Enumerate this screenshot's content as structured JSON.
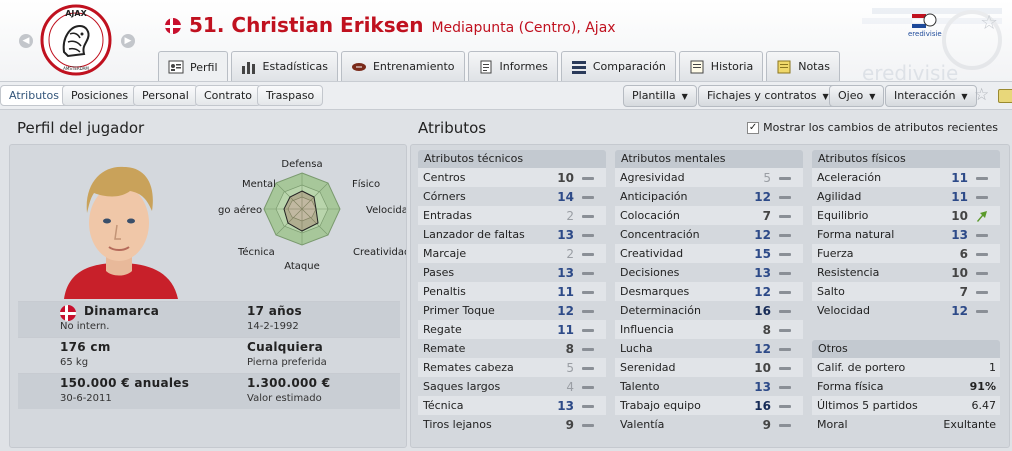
{
  "header": {
    "player_number_name": "51. Christian Eriksen",
    "position_club": "Mediapunta (Centro), Ajax",
    "logo_text": "AJAX",
    "logo_subtext": "AMSTERDAM",
    "league_logo_text": "eredivisie"
  },
  "tabs": [
    {
      "label": "Perfil",
      "icon": "profile-icon"
    },
    {
      "label": "Estadísticas",
      "icon": "stats-icon"
    },
    {
      "label": "Entrenamiento",
      "icon": "training-icon"
    },
    {
      "label": "Informes",
      "icon": "reports-icon"
    },
    {
      "label": "Comparación",
      "icon": "compare-icon"
    },
    {
      "label": "Historia",
      "icon": "history-icon"
    },
    {
      "label": "Notas",
      "icon": "notes-icon"
    }
  ],
  "subtabs": [
    "Atributos",
    "Posiciones",
    "Personal",
    "Contrato",
    "Traspaso"
  ],
  "dropdowns": [
    "Plantilla",
    "Fichajes y contratos",
    "Ojeo",
    "Interacción"
  ],
  "profile": {
    "title": "Perfil del jugador",
    "radar_labels": {
      "defensa": "Defensa",
      "fisico": "Físico",
      "velocidad": "Velocida",
      "creatividad": "Creatividad",
      "ataque": "Ataque",
      "tecnica": "Técnica",
      "juego_aereo": "go aéreo",
      "mental": "Mental"
    },
    "nationality": "Dinamarca",
    "international": "No intern.",
    "age": "17 años",
    "birth_date": "14-2-1992",
    "height": "176 cm",
    "weight": "65 kg",
    "foot": "Cualquiera",
    "foot_label": "Pierna preferida",
    "wage": "150.000 € anuales",
    "contract_end": "30-6-2011",
    "value": "1.300.000 €",
    "value_label": "Valor estimado"
  },
  "attributes": {
    "title": "Atributos",
    "recent_changes_label": "Mostrar los cambios de atributos recientes",
    "recent_changes_checked": true,
    "technical": {
      "title": "Atributos técnicos",
      "rows": [
        {
          "label": "Centros",
          "value": "10"
        },
        {
          "label": "Córners",
          "value": "14"
        },
        {
          "label": "Entradas",
          "value": "2"
        },
        {
          "label": "Lanzador de faltas",
          "value": "13"
        },
        {
          "label": "Marcaje",
          "value": "2"
        },
        {
          "label": "Pases",
          "value": "13"
        },
        {
          "label": "Penaltis",
          "value": "11"
        },
        {
          "label": "Primer Toque",
          "value": "12"
        },
        {
          "label": "Regate",
          "value": "11"
        },
        {
          "label": "Remate",
          "value": "8"
        },
        {
          "label": "Remates cabeza",
          "value": "5"
        },
        {
          "label": "Saques largos",
          "value": "4"
        },
        {
          "label": "Técnica",
          "value": "13"
        },
        {
          "label": "Tiros lejanos",
          "value": "9"
        }
      ]
    },
    "mental": {
      "title": "Atributos mentales",
      "rows": [
        {
          "label": "Agresividad",
          "value": "5"
        },
        {
          "label": "Anticipación",
          "value": "12"
        },
        {
          "label": "Colocación",
          "value": "7"
        },
        {
          "label": "Concentración",
          "value": "12"
        },
        {
          "label": "Creatividad",
          "value": "15"
        },
        {
          "label": "Decisiones",
          "value": "13"
        },
        {
          "label": "Desmarques",
          "value": "12"
        },
        {
          "label": "Determinación",
          "value": "16"
        },
        {
          "label": "Influencia",
          "value": "8"
        },
        {
          "label": "Lucha",
          "value": "12"
        },
        {
          "label": "Serenidad",
          "value": "10"
        },
        {
          "label": "Talento",
          "value": "13"
        },
        {
          "label": "Trabajo equipo",
          "value": "16"
        },
        {
          "label": "Valentía",
          "value": "9"
        }
      ]
    },
    "physical": {
      "title": "Atributos físicos",
      "rows": [
        {
          "label": "Aceleración",
          "value": "11"
        },
        {
          "label": "Agilidad",
          "value": "11"
        },
        {
          "label": "Equilibrio",
          "value": "10",
          "trend": "up"
        },
        {
          "label": "Forma natural",
          "value": "13"
        },
        {
          "label": "Fuerza",
          "value": "6"
        },
        {
          "label": "Resistencia",
          "value": "10"
        },
        {
          "label": "Salto",
          "value": "7"
        },
        {
          "label": "Velocidad",
          "value": "12"
        }
      ]
    },
    "others": {
      "title": "Otros",
      "rows": [
        {
          "label": "Calif. de portero",
          "value": "1"
        },
        {
          "label": "Forma física",
          "value": "91%"
        },
        {
          "label": "Últimos 5 partidos",
          "value": "6.47"
        },
        {
          "label": "Moral",
          "value": "Exultante"
        }
      ]
    }
  },
  "colors": {
    "name_red": "#c0111f",
    "value_blue": "#2d4a88",
    "trend_up_green": "#5a9a2a"
  }
}
